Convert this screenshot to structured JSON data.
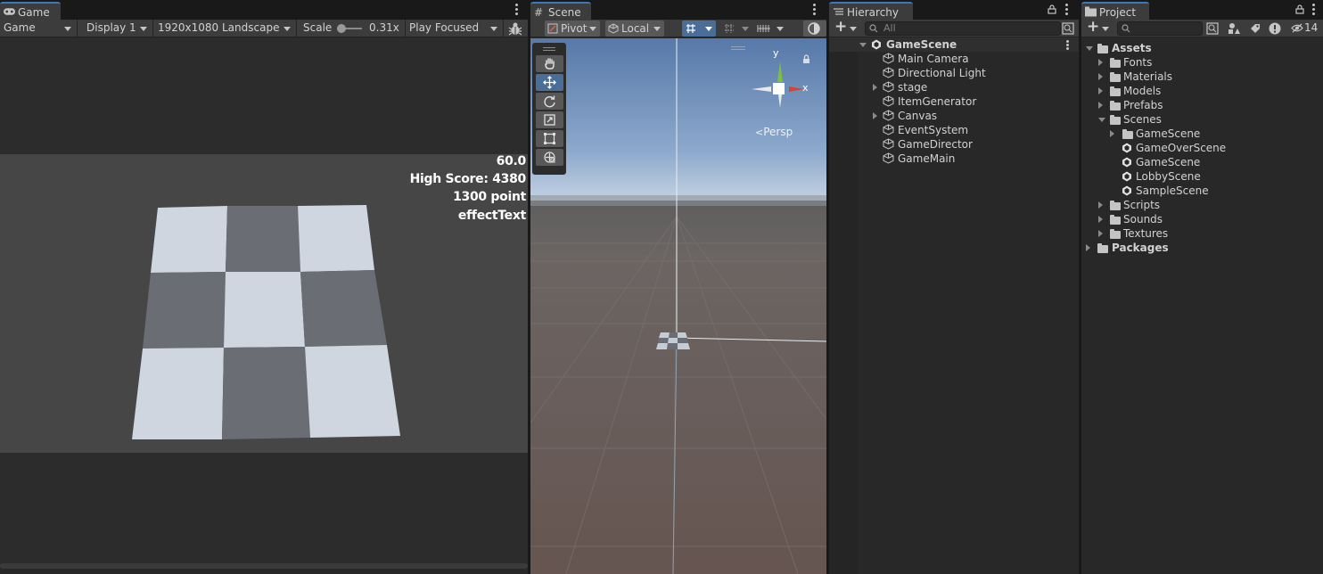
{
  "game": {
    "tab_label": "Game",
    "view_mode": "Game",
    "display": "Display 1",
    "resolution": "1920x1080 Landscape",
    "scale_label": "Scale",
    "scale_value": "0.31x",
    "play_mode": "Play Focused",
    "hud": {
      "fps": "60.0",
      "high_score": "High Score: 4380",
      "points": "1300 point",
      "effect": "effectText"
    }
  },
  "scene": {
    "tab_label": "Scene",
    "pivot": "Pivot",
    "space": "Local",
    "persp_label": "Persp",
    "gizmo_y": "y",
    "gizmo_x": "x"
  },
  "hierarchy": {
    "tab_label": "Hierarchy",
    "search_placeholder": "All",
    "root": "GameScene",
    "items": [
      "Main Camera",
      "Directional Light",
      "stage",
      "ItemGenerator",
      "Canvas",
      "EventSystem",
      "GameDirector",
      "GameMain"
    ]
  },
  "project": {
    "tab_label": "Project",
    "hidden_count": "14",
    "assets_label": "Assets",
    "folders": [
      "Fonts",
      "Materials",
      "Models",
      "Prefabs",
      "Scenes"
    ],
    "scene_folder": "GameScene",
    "scenes": [
      "GameOverScene",
      "GameScene",
      "LobbyScene",
      "SampleScene"
    ],
    "more_folders": [
      "Scripts",
      "Sounds",
      "Textures"
    ],
    "packages_label": "Packages"
  },
  "colors": {
    "accent": "#3a79bb",
    "panel_bg": "#282828",
    "toolbar_bg": "#3c3c3c"
  }
}
